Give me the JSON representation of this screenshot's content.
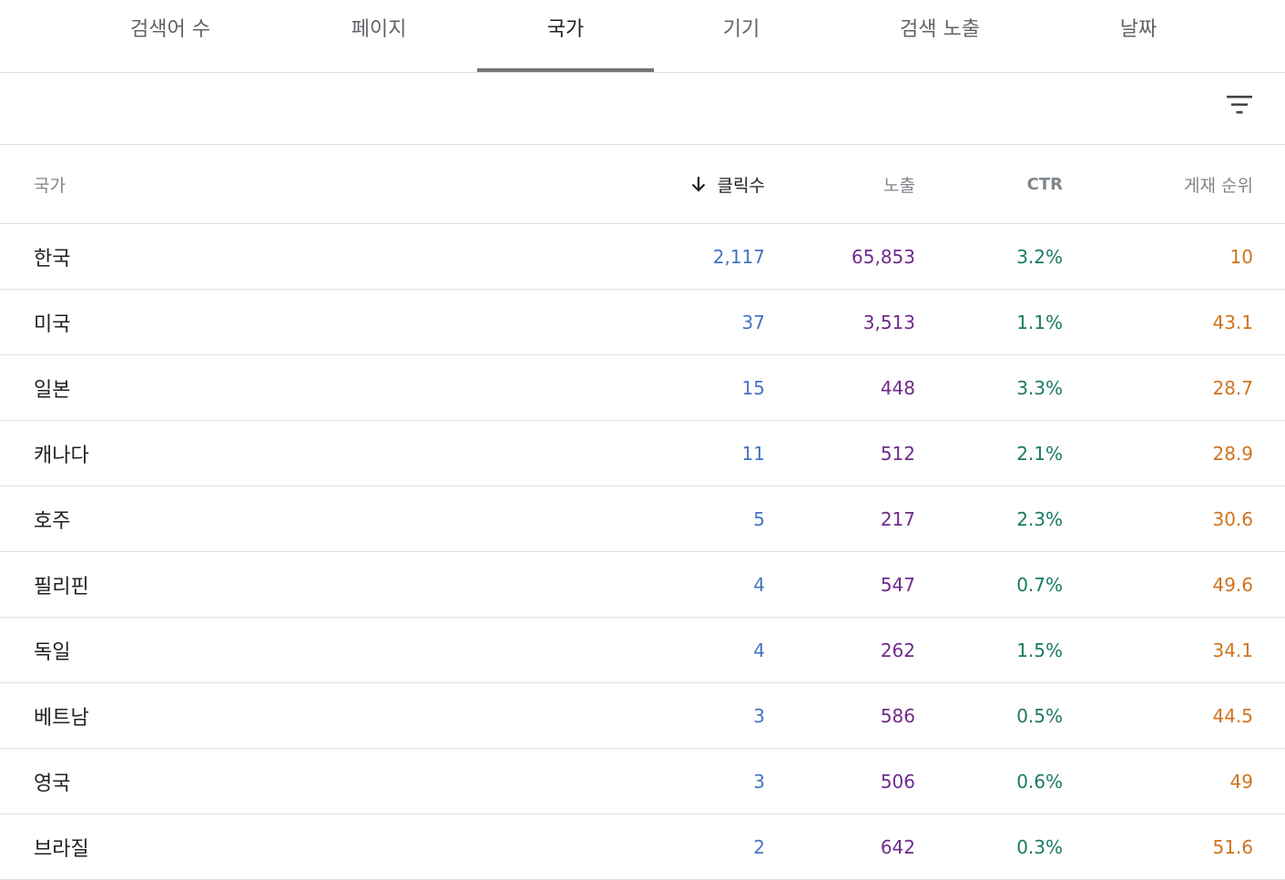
{
  "tabs": [
    {
      "label": "검색어 수"
    },
    {
      "label": "페이지"
    },
    {
      "label": "국가"
    },
    {
      "label": "기기"
    },
    {
      "label": "검색 노출"
    },
    {
      "label": "날짜"
    }
  ],
  "active_tab": "국가",
  "toolbar": {
    "filter_icon": "filter-icon"
  },
  "table": {
    "headers": {
      "country": "국가",
      "clicks": "클릭수",
      "impressions": "노출",
      "ctr": "CTR",
      "position": "게재 순위"
    },
    "sort": {
      "column": "clicks",
      "direction": "desc",
      "icon": "arrow-down-icon"
    },
    "rows": [
      {
        "country": "한국",
        "clicks": "2,117",
        "impressions": "65,853",
        "ctr": "3.2%",
        "position": "10"
      },
      {
        "country": "미국",
        "clicks": "37",
        "impressions": "3,513",
        "ctr": "1.1%",
        "position": "43.1"
      },
      {
        "country": "일본",
        "clicks": "15",
        "impressions": "448",
        "ctr": "3.3%",
        "position": "28.7"
      },
      {
        "country": "캐나다",
        "clicks": "11",
        "impressions": "512",
        "ctr": "2.1%",
        "position": "28.9"
      },
      {
        "country": "호주",
        "clicks": "5",
        "impressions": "217",
        "ctr": "2.3%",
        "position": "30.6"
      },
      {
        "country": "필리핀",
        "clicks": "4",
        "impressions": "547",
        "ctr": "0.7%",
        "position": "49.6"
      },
      {
        "country": "독일",
        "clicks": "4",
        "impressions": "262",
        "ctr": "1.5%",
        "position": "34.1"
      },
      {
        "country": "베트남",
        "clicks": "3",
        "impressions": "586",
        "ctr": "0.5%",
        "position": "44.5"
      },
      {
        "country": "영국",
        "clicks": "3",
        "impressions": "506",
        "ctr": "0.6%",
        "position": "49"
      },
      {
        "country": "브라질",
        "clicks": "2",
        "impressions": "642",
        "ctr": "0.3%",
        "position": "51.6"
      }
    ]
  },
  "colors": {
    "clicks": "#4374c4",
    "impressions": "#6f2a8c",
    "ctr": "#1a7a64",
    "position": "#d0731e"
  }
}
